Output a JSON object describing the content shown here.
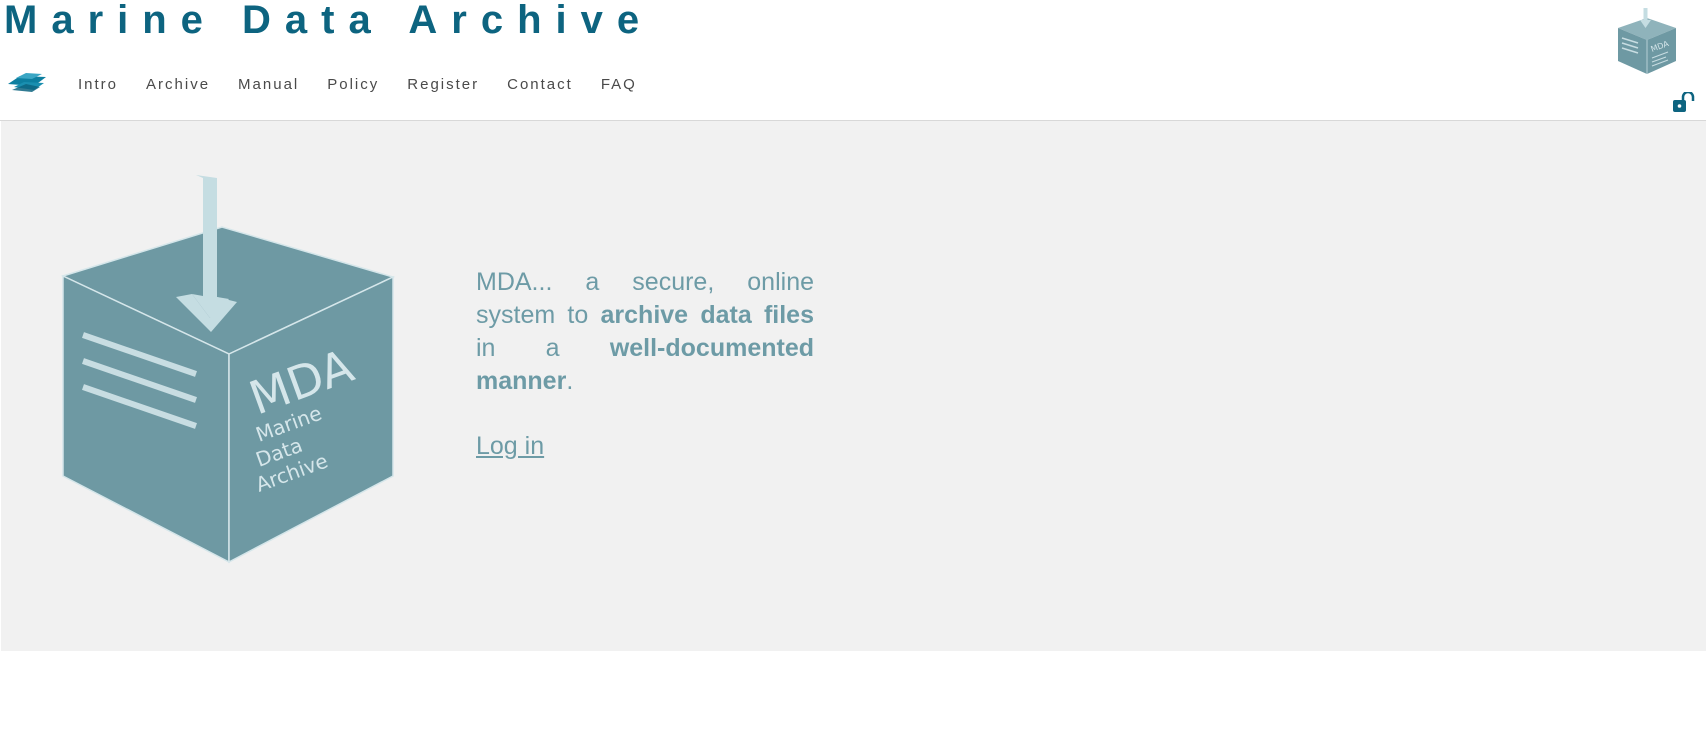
{
  "site": {
    "title": "Marine Data Archive"
  },
  "nav": {
    "items": [
      {
        "label": "Intro"
      },
      {
        "label": "Archive"
      },
      {
        "label": "Manual"
      },
      {
        "label": "Policy"
      },
      {
        "label": "Register"
      },
      {
        "label": "Contact"
      },
      {
        "label": "FAQ"
      }
    ]
  },
  "hero": {
    "text_1": "MDA... a secure, online system to ",
    "text_bold_1": "archive data files",
    "text_2": " in a ",
    "text_bold_2": "well-documented manner",
    "text_3": ".",
    "login_label": "Log in",
    "box_label_main": "MDA",
    "box_label_line1": "Marine",
    "box_label_line2": "Data",
    "box_label_line3": "Archive"
  },
  "colors": {
    "brand": "#0d6480",
    "box": "#6e99a3",
    "text_accent": "#6d9ba6",
    "hero_bg": "#f1f1f1"
  },
  "icons": {
    "logo": "layers-icon",
    "corner": "archive-box-icon",
    "lock": "unlock-icon"
  }
}
